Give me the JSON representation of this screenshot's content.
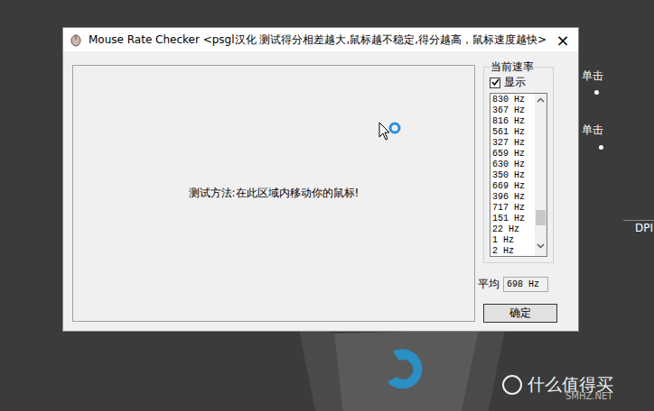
{
  "window": {
    "title": "Mouse Rate Checker <psgl汉化  测试得分相差越大,鼠标越不稳定,得分越高，鼠标速度越快>",
    "close": "×"
  },
  "test_area": {
    "instruction": "测试方法:在此区域内移动你的鼠标!"
  },
  "rate_group": {
    "label": "当前速率",
    "show": {
      "label": "显示",
      "checked": true
    },
    "rates": [
      "830 Hz",
      "367 Hz",
      "816 Hz",
      "561 Hz",
      "327 Hz",
      "659 Hz",
      "630 Hz",
      "350 Hz",
      "669 Hz",
      "396 Hz",
      "717 Hz",
      "151 Hz",
      "22 Hz",
      "1 Hz",
      "2 Hz"
    ],
    "scroll": {
      "level": 0.88
    }
  },
  "average": {
    "label": "平均",
    "value": "698 Hz"
  },
  "buttons": [
    "确定"
  ],
  "background": {
    "labels": [
      "单击",
      "单击",
      "DPI"
    ],
    "watermark": {
      "brand": "什么值得买",
      "site": "SMHZ.NET"
    }
  }
}
